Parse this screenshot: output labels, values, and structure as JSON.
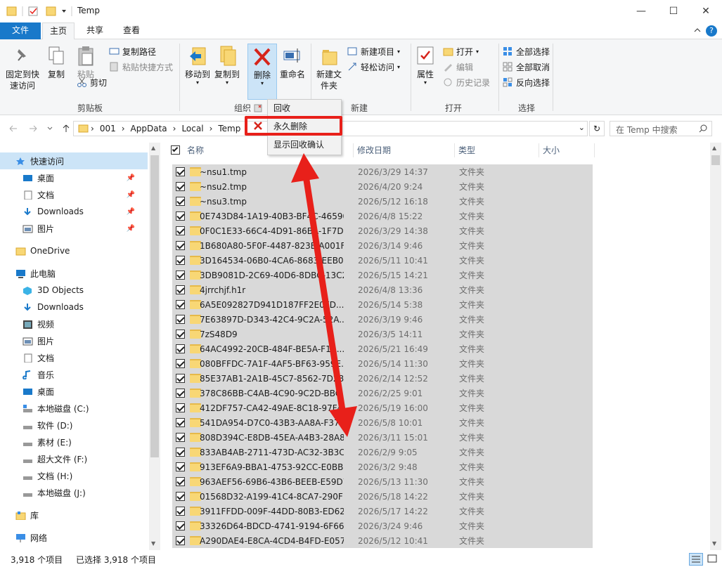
{
  "window": {
    "title": "Temp",
    "minimize": "—",
    "maximize": "☐",
    "close": "✕",
    "help": "?"
  },
  "tabs": {
    "file": "文件",
    "home": "主页",
    "share": "共享",
    "view": "查看"
  },
  "ribbon": {
    "clipboard": {
      "group": "剪贴板",
      "pin": "固定到快速访问",
      "copy": "复制",
      "paste": "粘贴",
      "copy_path": "复制路径",
      "paste_shortcut": "粘贴快捷方式",
      "cut": "剪切"
    },
    "organize": {
      "group": "组织",
      "move_to": "移动到",
      "copy_to": "复制到",
      "delete": "删除",
      "rename": "重命名"
    },
    "new": {
      "group": "新建",
      "new_folder": "新建文件夹",
      "new_item": "新建项目",
      "easy_access": "轻松访问"
    },
    "open": {
      "group": "打开",
      "properties": "属性",
      "open": "打开",
      "edit": "编辑",
      "history": "历史记录"
    },
    "select": {
      "group": "选择",
      "select_all": "全部选择",
      "select_none": "全部取消",
      "invert": "反向选择"
    }
  },
  "delete_menu": {
    "recycle": "回收",
    "permanent": "永久删除",
    "confirm": "显示回收确认"
  },
  "address": {
    "crumbs": [
      "001",
      "AppData",
      "Local",
      "Temp"
    ],
    "search_placeholder": "在 Temp 中搜索"
  },
  "nav": [
    {
      "label": "快速访问",
      "icon": "star-icon",
      "level": 0,
      "selected": true
    },
    {
      "label": "桌面",
      "icon": "desktop-icon",
      "level": 1,
      "pinned": true
    },
    {
      "label": "文档",
      "icon": "document-icon",
      "level": 1,
      "pinned": true
    },
    {
      "label": "Downloads",
      "icon": "download-icon",
      "level": 1,
      "pinned": true
    },
    {
      "label": "图片",
      "icon": "picture-icon",
      "level": 1,
      "pinned": true
    },
    {
      "label": "",
      "icon": "",
      "level": -1
    },
    {
      "label": "OneDrive",
      "icon": "folder-icon",
      "level": 0
    },
    {
      "label": "",
      "icon": "",
      "level": -1
    },
    {
      "label": "此电脑",
      "icon": "computer-icon",
      "level": 0
    },
    {
      "label": "3D Objects",
      "icon": "cube-icon",
      "level": 1
    },
    {
      "label": "Downloads",
      "icon": "download-icon",
      "level": 1
    },
    {
      "label": "视频",
      "icon": "video-icon",
      "level": 1
    },
    {
      "label": "图片",
      "icon": "picture-icon",
      "level": 1
    },
    {
      "label": "文档",
      "icon": "document-icon",
      "level": 1
    },
    {
      "label": "音乐",
      "icon": "music-icon",
      "level": 1
    },
    {
      "label": "桌面",
      "icon": "desktop-icon",
      "level": 1
    },
    {
      "label": "本地磁盘 (C:)",
      "icon": "drive-c-icon",
      "level": 1
    },
    {
      "label": "软件 (D:)",
      "icon": "drive-icon",
      "level": 1
    },
    {
      "label": "素材 (E:)",
      "icon": "drive-icon",
      "level": 1
    },
    {
      "label": "超大文件 (F:)",
      "icon": "drive-icon",
      "level": 1
    },
    {
      "label": "文档 (H:)",
      "icon": "drive-icon",
      "level": 1
    },
    {
      "label": "本地磁盘 (J:)",
      "icon": "drive-icon",
      "level": 1
    },
    {
      "label": "",
      "icon": "",
      "level": -1
    },
    {
      "label": "库",
      "icon": "library-icon",
      "level": 0
    },
    {
      "label": "",
      "icon": "",
      "level": -1
    },
    {
      "label": "网络",
      "icon": "network-icon",
      "level": 0
    }
  ],
  "columns": {
    "name": "名称",
    "date": "修改日期",
    "type": "类型",
    "size": "大小"
  },
  "files": [
    {
      "name": "~nsu1.tmp",
      "date": "2026/3/29 14:37",
      "type": "文件夹"
    },
    {
      "name": "~nsu2.tmp",
      "date": "2026/4/20 9:24",
      "type": "文件夹"
    },
    {
      "name": "~nsu3.tmp",
      "date": "2026/5/12 16:18",
      "type": "文件夹"
    },
    {
      "name": "0E743D84-1A19-40B3-BF4C-46590...",
      "date": "2026/4/8 15:22",
      "type": "文件夹"
    },
    {
      "name": "0F0C1E33-66C4-4D91-86BA-1F7DF...",
      "date": "2026/3/29 14:38",
      "type": "文件夹"
    },
    {
      "name": "1B680A80-5F0F-4487-823E-A001F5...",
      "date": "2026/3/14 9:46",
      "type": "文件夹"
    },
    {
      "name": "3D164534-06B0-4CA6-8683-EEB03...",
      "date": "2026/5/11 10:41",
      "type": "文件夹"
    },
    {
      "name": "3DB9081D-2C69-40D6-8DBC-13C2...",
      "date": "2026/5/15 14:21",
      "type": "文件夹"
    },
    {
      "name": "4jrrchjf.h1r",
      "date": "2026/4/8 13:36",
      "type": "文件夹"
    },
    {
      "name": "6A5E092827D941D187FF2E0FD...",
      "date": "2026/5/14 5:38",
      "type": "文件夹"
    },
    {
      "name": "7E63897D-D343-42C4-9C2A-52A...",
      "date": "2026/3/19 9:46",
      "type": "文件夹"
    },
    {
      "name": "7zS48D9",
      "date": "2026/3/5 14:11",
      "type": "文件夹"
    },
    {
      "name": "64AC4992-20CB-484F-BE5A-F1A...",
      "date": "2026/5/21 16:49",
      "type": "文件夹"
    },
    {
      "name": "080BFFDC-7A1F-4AF5-BF63-959E...",
      "date": "2026/5/14 11:30",
      "type": "文件夹"
    },
    {
      "name": "85E37AB1-2A1B-45C7-8562-7D28...",
      "date": "2026/2/14 12:52",
      "type": "文件夹"
    },
    {
      "name": "378C86BB-C4AB-4C90-9C2D-BBC...",
      "date": "2026/2/25 9:01",
      "type": "文件夹"
    },
    {
      "name": "412DF757-CA42-49AE-8C18-97F4A...",
      "date": "2026/5/19 16:00",
      "type": "文件夹"
    },
    {
      "name": "541DA954-D7C0-43B3-AA8A-F374...",
      "date": "2026/5/8 10:01",
      "type": "文件夹"
    },
    {
      "name": "808D394C-E8DB-45EA-A4B3-28A8...",
      "date": "2026/3/11 15:01",
      "type": "文件夹"
    },
    {
      "name": "833AB4AB-2711-473D-AC32-3B3C...",
      "date": "2026/2/9 9:05",
      "type": "文件夹"
    },
    {
      "name": "913EF6A9-BBA1-4753-92CC-E0BB8...",
      "date": "2026/3/2 9:48",
      "type": "文件夹"
    },
    {
      "name": "963AEF56-69B6-43B6-BEEB-E59D7...",
      "date": "2026/5/13 11:30",
      "type": "文件夹"
    },
    {
      "name": "01568D32-A199-41C4-8CA7-290F1...",
      "date": "2026/5/18 14:22",
      "type": "文件夹"
    },
    {
      "name": "3911FFDD-009F-44DD-80B3-ED62...",
      "date": "2026/5/17 14:22",
      "type": "文件夹"
    },
    {
      "name": "33326D64-BDCD-4741-9194-6F666...",
      "date": "2026/3/24 9:46",
      "type": "文件夹"
    },
    {
      "name": "A290DAE4-E8CA-4CD4-B4FD-E057...",
      "date": "2026/5/12 10:41",
      "type": "文件夹"
    }
  ],
  "status": {
    "count": "3,918 个项目",
    "selected": "已选择 3,918 个项目"
  },
  "colors": {
    "accent": "#1979ca",
    "highlight": "#e8201a",
    "selection": "#d9d9d9"
  }
}
